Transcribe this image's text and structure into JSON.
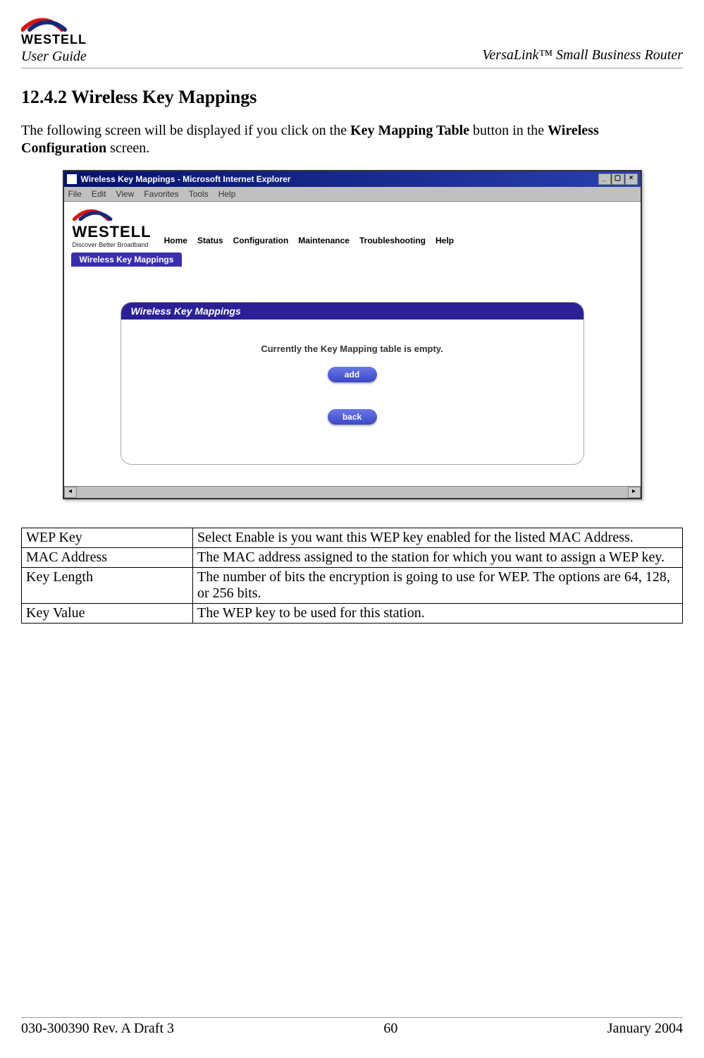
{
  "header": {
    "brand": "WESTELL",
    "doc_label": "User Guide",
    "product": "VersaLink™  Small Business Router"
  },
  "section": {
    "number": "12.4.2",
    "title": "Wireless Key Mappings",
    "heading": "12.4.2  Wireless Key Mappings",
    "para_pre": "The following screen will be displayed if you click on the ",
    "para_bold1": "Key Mapping Table",
    "para_mid": " button in the ",
    "para_bold2": "Wireless Configuration",
    "para_post": " screen."
  },
  "screenshot": {
    "window_title": "Wireless Key Mappings - Microsoft Internet Explorer",
    "menus": [
      "File",
      "Edit",
      "View",
      "Favorites",
      "Tools",
      "Help"
    ],
    "brand": "WESTELL",
    "tagline": "Discover Better Broadband",
    "nav": [
      "Home",
      "Status",
      "Configuration",
      "Maintenance",
      "Troubleshooting",
      "Help"
    ],
    "tab": "Wireless Key Mappings",
    "panel_title": "Wireless Key Mappings",
    "empty_msg": "Currently the Key Mapping table is empty.",
    "add_btn": "add",
    "back_btn": "back"
  },
  "table": {
    "rows": [
      {
        "k": "WEP Key",
        "v": "Select Enable is you want this WEP key enabled for the listed MAC Address."
      },
      {
        "k": "MAC Address",
        "v": "The MAC address assigned to the station for which you want to assign a WEP key."
      },
      {
        "k": "Key Length",
        "v": "The number of bits the encryption is going to use for WEP. The options are 64, 128, or 256 bits."
      },
      {
        "k": "Key Value",
        "v": "The WEP key to be used for this station."
      }
    ]
  },
  "footer": {
    "left": "030-300390 Rev. A Draft 3",
    "center": "60",
    "right": "January 2004"
  }
}
